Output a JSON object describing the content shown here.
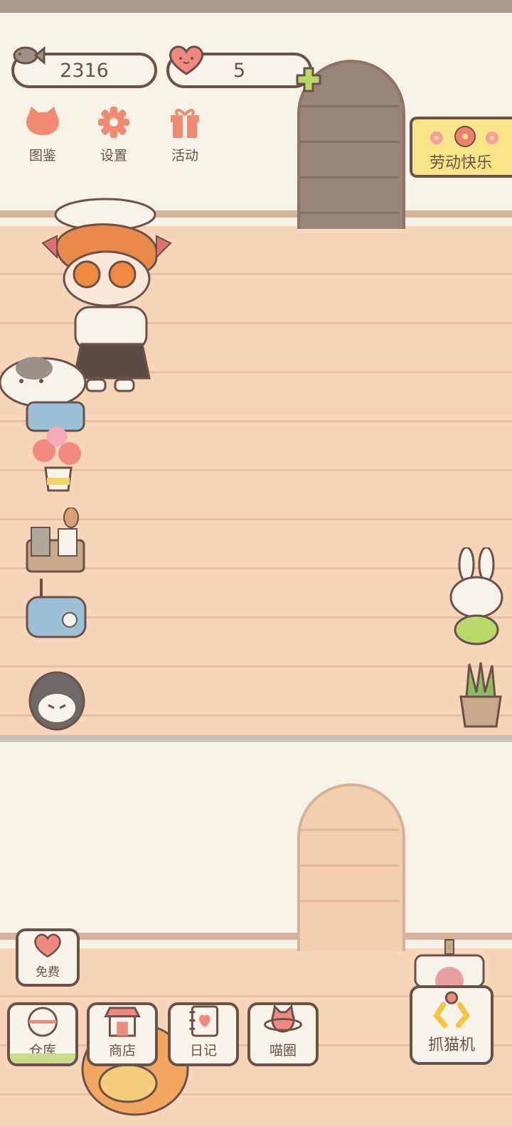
{
  "stats": {
    "fish_count": "2316",
    "hearts_count": "5"
  },
  "menu": {
    "catalog_label": "图鉴",
    "settings_label": "设置",
    "events_label": "活动"
  },
  "banner": {
    "label": "劳动快乐"
  },
  "bottom_bar": {
    "free_label": "免费",
    "warehouse_label": "仓库",
    "shop_label": "商店",
    "diary_label": "日记",
    "circle_label": "喵圈",
    "claw_label": "抓猫机"
  },
  "colors": {
    "accent_pink": "#f08070",
    "outline_brown": "#6b5248",
    "plus_green": "#b8d86a",
    "banner_yellow": "#f7e486"
  }
}
